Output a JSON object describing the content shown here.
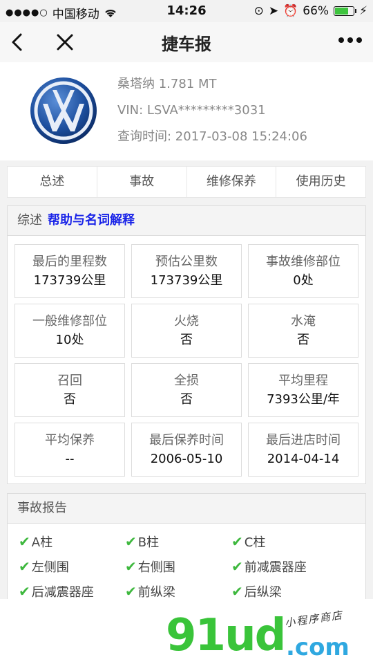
{
  "statusbar": {
    "carrier": "中国移动",
    "time": "14:26",
    "battery": "66%",
    "battery_level": 0.66
  },
  "nav": {
    "title": "捷车报"
  },
  "car": {
    "model": "桑塔纳 1.781 MT",
    "vin": "VIN: LSVA*********3031",
    "query_time": "查询时间: 2017-03-08 15:24:06"
  },
  "tabs": [
    "总述",
    "事故",
    "维修保养",
    "使用历史"
  ],
  "summary": {
    "title": "综述",
    "help": "帮助与名词解释",
    "cells": [
      {
        "label": "最后的里程数",
        "value": "173739公里"
      },
      {
        "label": "预估公里数",
        "value": "173739公里"
      },
      {
        "label": "事故维修部位",
        "value": "0处"
      },
      {
        "label": "一般维修部位",
        "value": "10处"
      },
      {
        "label": "火烧",
        "value": "否"
      },
      {
        "label": "水淹",
        "value": "否"
      },
      {
        "label": "召回",
        "value": "否"
      },
      {
        "label": "全损",
        "value": "否"
      },
      {
        "label": "平均里程",
        "value": "7393公里/年"
      },
      {
        "label": "平均保养",
        "value": "--"
      },
      {
        "label": "最后保养时间",
        "value": "2006-05-10"
      },
      {
        "label": "最后进店时间",
        "value": "2014-04-14"
      }
    ]
  },
  "accident": {
    "title": "事故报告",
    "items": [
      "A柱",
      "B柱",
      "C柱",
      "左侧围",
      "右侧围",
      "前减震器座",
      "后减震器座",
      "前纵梁",
      "后纵梁"
    ]
  },
  "watermark": {
    "main": "91ud",
    "com": ".com",
    "sub": "小程序商店"
  }
}
